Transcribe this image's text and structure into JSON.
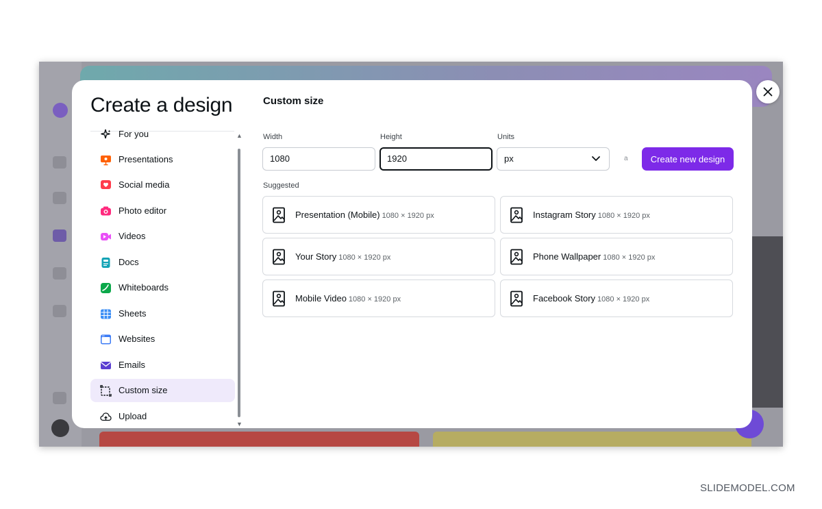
{
  "modal": {
    "title": "Create a design",
    "nav": [
      {
        "label": "For you",
        "icon": "sparkle-icon",
        "color": "#0d1216"
      },
      {
        "label": "Presentations",
        "icon": "presentation-icon",
        "color": "#ff6105"
      },
      {
        "label": "Social media",
        "icon": "heart-icon",
        "color": "#ff3b4b"
      },
      {
        "label": "Photo editor",
        "icon": "camera-icon",
        "color": "#ff2a7e"
      },
      {
        "label": "Videos",
        "icon": "video-icon",
        "color": "#e950f7"
      },
      {
        "label": "Docs",
        "icon": "doc-icon",
        "color": "#13a3b5"
      },
      {
        "label": "Whiteboards",
        "icon": "whiteboard-icon",
        "color": "#0ba84a"
      },
      {
        "label": "Sheets",
        "icon": "sheet-icon",
        "color": "#3a8df5"
      },
      {
        "label": "Websites",
        "icon": "website-icon",
        "color": "#3c7bf5"
      },
      {
        "label": "Emails",
        "icon": "email-icon",
        "color": "#5b3fd1"
      },
      {
        "label": "Custom size",
        "icon": "custom-size-icon",
        "color": "#0d1216",
        "active": true
      },
      {
        "label": "Upload",
        "icon": "upload-icon",
        "color": "#0d1216"
      }
    ],
    "content": {
      "title": "Custom size",
      "width_label": "Width",
      "width_value": "1080",
      "height_label": "Height",
      "height_value": "1920",
      "units_label": "Units",
      "units_value": "px",
      "lock_mark": "a",
      "create_label": "Create new design",
      "suggested_label": "Suggested",
      "suggestions": [
        {
          "name": "Presentation (Mobile)",
          "dims": "1080 × 1920 px"
        },
        {
          "name": "Instagram Story",
          "dims": "1080 × 1920 px"
        },
        {
          "name": "Your Story",
          "dims": "1080 × 1920 px"
        },
        {
          "name": "Phone Wallpaper",
          "dims": "1080 × 1920 px"
        },
        {
          "name": "Mobile Video",
          "dims": "1080 × 1920 px"
        },
        {
          "name": "Facebook Story",
          "dims": "1080 × 1920 px"
        }
      ]
    }
  },
  "colors": {
    "accent": "#7d2ae8",
    "active_bg": "#efeafb"
  },
  "watermark": "SLIDEMODEL.COM"
}
